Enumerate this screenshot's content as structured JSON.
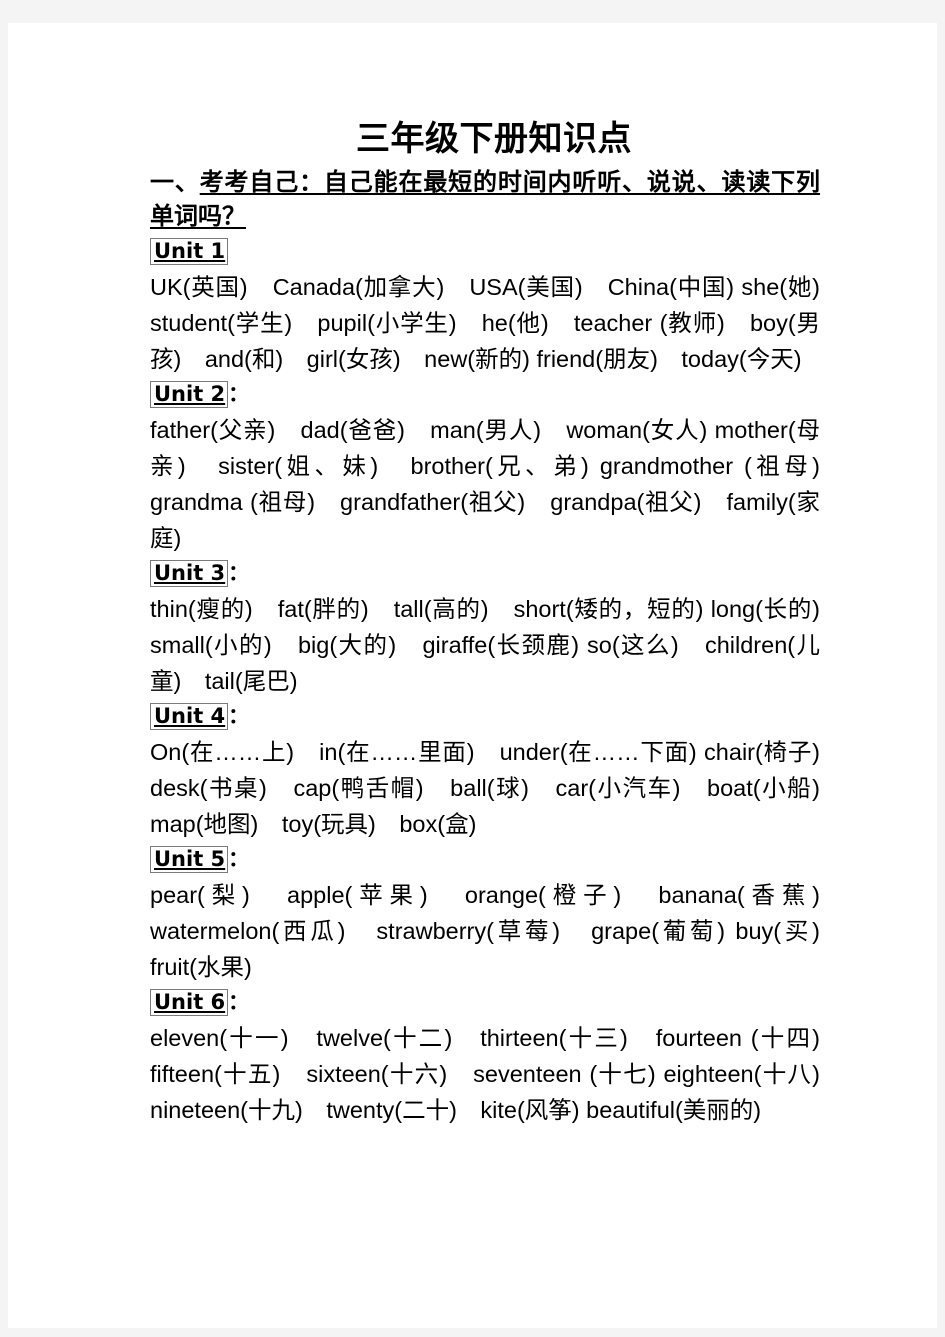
{
  "document": {
    "title": "三年级下册知识点",
    "section_heading": {
      "number": "一、",
      "underlined_text": "考考自己：自己能在最短的时间内听听、说说、读读下列单词吗？"
    },
    "units": [
      {
        "label": "Unit 1",
        "colon": "",
        "words": "UK(英国)　Canada(加拿大)　USA(美国)　China(中国) she(她)　student(学生)　pupil(小学生)　he(他)　teacher (教师)　boy(男孩)　and(和)　girl(女孩)　new(新的) friend(朋友)　today(今天)"
      },
      {
        "label": "Unit 2",
        "colon": "：",
        "words": "father(父亲)　dad(爸爸)　man(男人)　woman(女人) mother(母亲)　sister(姐、妹)　brother(兄、弟) grandmother (祖母)　grandma (祖母)　grandfather(祖父)　grandpa(祖父)　family(家庭)"
      },
      {
        "label": "Unit 3",
        "colon": "：",
        "words": "thin(瘦的)　fat(胖的)　tall(高的)　short(矮的，短的) long(长的)　small(小的)　big(大的)　giraffe(长颈鹿) so(这么)　children(儿童)　tail(尾巴)"
      },
      {
        "label": "Unit 4",
        "colon": "：",
        "words": "On(在……上)　in(在……里面)　under(在……下面) chair(椅子)　desk(书桌)　cap(鸭舌帽)　ball(球)　car(小汽车)　boat(小船)　map(地图)　toy(玩具)　box(盒)"
      },
      {
        "label": "Unit 5",
        "colon": "：",
        "words": "pear(梨)　apple(苹果)　orange(橙子)　banana(香蕉) watermelon(西瓜)　strawberry(草莓)　grape(葡萄) buy(买)　fruit(水果)"
      },
      {
        "label": "Unit 6",
        "colon": "：",
        "words": "eleven(十一)　twelve(十二)　thirteen(十三)　fourteen (十四)　fifteen(十五)　sixteen(十六)　seventeen (十七) eighteen(十八)　nineteen(十九)　twenty(二十)　kite(风筝) beautiful(美丽的)"
      }
    ]
  }
}
